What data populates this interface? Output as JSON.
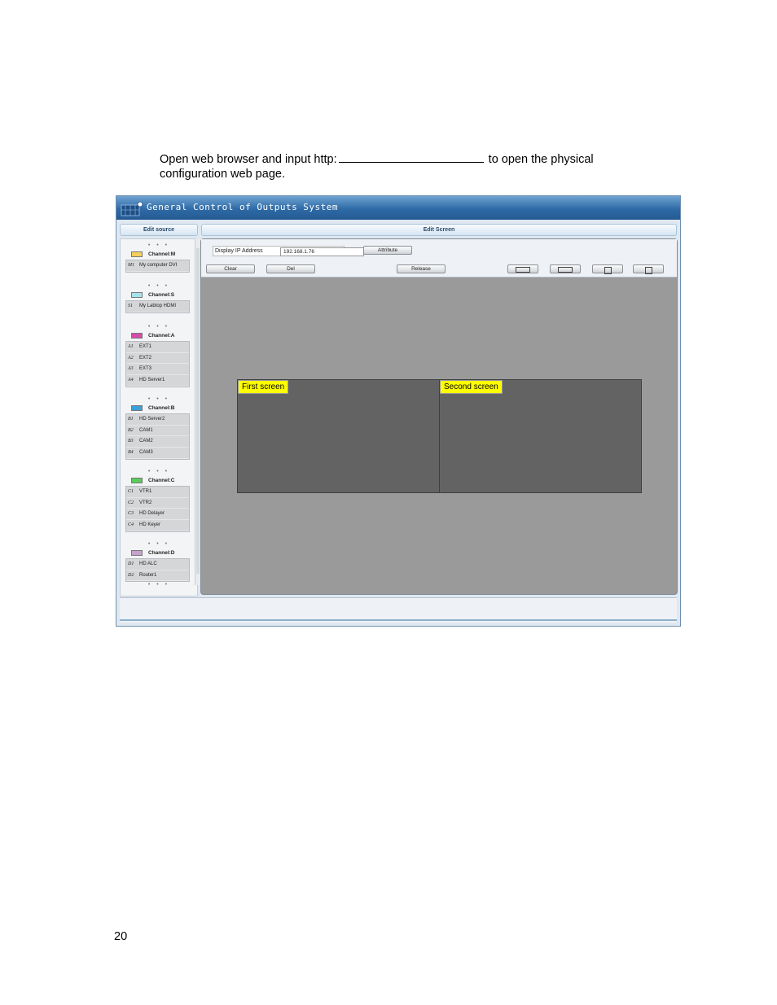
{
  "intro": {
    "before_blank": "Open web browser and input http:",
    "after_blank": " to open the physical",
    "line2": "configuration web page."
  },
  "page_number": "20",
  "app": {
    "title": "General Control of Outputs System",
    "left_header": "Edit source",
    "right_header": "Edit Screen"
  },
  "toolbar": {
    "ip_label": "Display IP Address",
    "ip_value": "192.168.1.76",
    "attribute": "Attribute",
    "clear": "Clear",
    "del": "Del",
    "release": "Release"
  },
  "dots": "• • •",
  "channels": [
    {
      "label": "Channel:M",
      "color": "#f5cf5a",
      "items": [
        {
          "code": "M1",
          "name": "My computer DVI"
        }
      ]
    },
    {
      "label": "Channel:S",
      "color": "#a8e2ec",
      "items": [
        {
          "code": "S1",
          "name": "My Labtop HDMI"
        }
      ]
    },
    {
      "label": "Channel:A",
      "color": "#d84aa8",
      "items": [
        {
          "code": "A1",
          "name": "EXT1"
        },
        {
          "code": "A2",
          "name": "EXT2"
        },
        {
          "code": "A3",
          "name": "EXT3"
        },
        {
          "code": "A4",
          "name": "HD Server1"
        }
      ]
    },
    {
      "label": "Channel:B",
      "color": "#3aa0d8",
      "items": [
        {
          "code": "B1",
          "name": "HD Server2"
        },
        {
          "code": "B2",
          "name": "CAM1"
        },
        {
          "code": "B3",
          "name": "CAM2"
        },
        {
          "code": "B4",
          "name": "CAM3"
        }
      ]
    },
    {
      "label": "Channel:C",
      "color": "#5ccc5a",
      "items": [
        {
          "code": "C1",
          "name": "VTR1"
        },
        {
          "code": "C2",
          "name": "VTR2"
        },
        {
          "code": "C3",
          "name": "HD Delayer"
        },
        {
          "code": "C4",
          "name": "HD Keyer"
        }
      ]
    },
    {
      "label": "Channel:D",
      "color": "#c8a0cc",
      "items": [
        {
          "code": "D1",
          "name": "HD ALC"
        },
        {
          "code": "D2",
          "name": "Router1"
        }
      ]
    }
  ],
  "screens": [
    {
      "label": "First screen"
    },
    {
      "label": "Second screen"
    }
  ]
}
